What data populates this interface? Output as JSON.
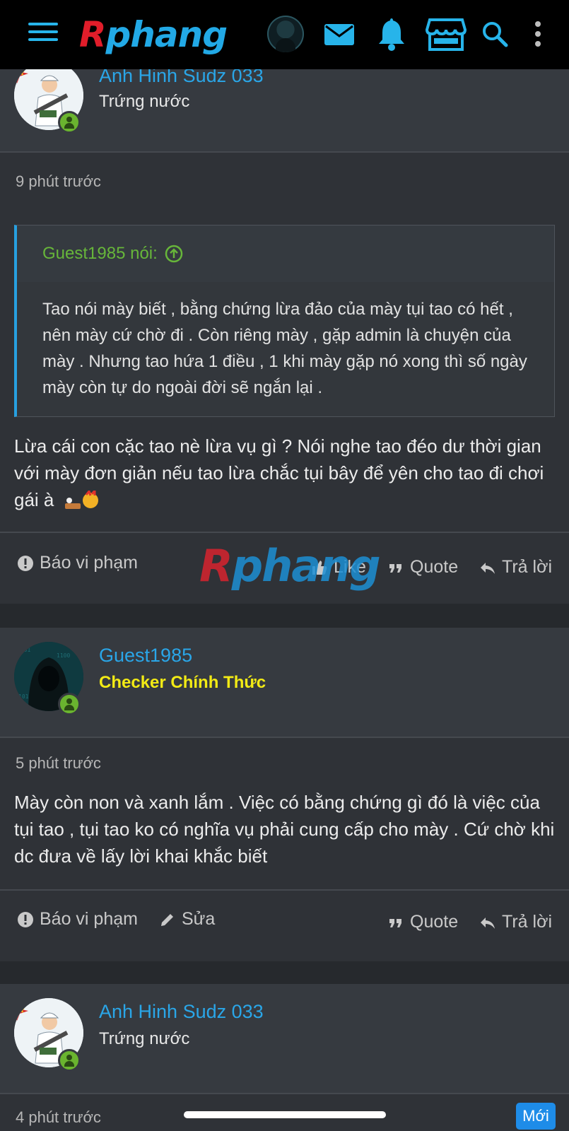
{
  "topbar": {
    "logo_first": "R",
    "logo_rest": "phang",
    "icons": [
      "menu-icon",
      "avatar",
      "mail-icon",
      "bell-icon",
      "store-icon",
      "search-icon",
      "more-vertical-icon"
    ]
  },
  "posts": [
    {
      "username": "Anh Hinh Sudz 033",
      "user_title": "Trứng nước",
      "time": "9 phút trước",
      "quote": {
        "author": "Guest1985 nói:",
        "text": "Tao nói mày biết , bằng chứng lừa đảo của mày tụi tao có hết , nên mày cứ chờ đi . Còn riêng mày , gặp admin là chuyện của mày . Nhưng tao hứa 1 điều , 1 khi mày gặp nó xong thì số ngày mày còn tự do ngoài đời sẽ ngắn lại ."
      },
      "body": "Lừa cái con cặc tao nè lừa vụ gì ? Nói nghe tao đéo dư thời gian với mày đơn giản nếu tao lừa chắc tụi bây để yên cho tao đi chơi gái à",
      "actions": {
        "report": "Báo vi phạm",
        "like": "Like",
        "quote": "Quote",
        "reply": "Trả lời"
      }
    },
    {
      "username": "Guest1985",
      "user_title": "Checker Chính Thức",
      "time": "5 phút trước",
      "body": "Mày còn non và xanh lắm . Việc có bằng chứng gì đó là việc của tụi tao , tụi tao ko có nghĩa vụ phải cung cấp cho mày . Cứ chờ khi dc đưa về lấy lời khai khắc biết",
      "actions": {
        "report": "Báo vi phạm",
        "edit": "Sửa",
        "quote": "Quote",
        "reply": "Trả lời"
      }
    },
    {
      "username": "Anh Hinh Sudz 033",
      "user_title": "Trứng nước",
      "time": "4 phút trước",
      "badge": "Mới"
    }
  ],
  "watermark": {
    "first": "R",
    "rest": "phang"
  },
  "colors": {
    "accent": "#2aa6e8",
    "online": "#6ab42f",
    "checker": "#f2ea15",
    "quote_author": "#67b63a"
  }
}
